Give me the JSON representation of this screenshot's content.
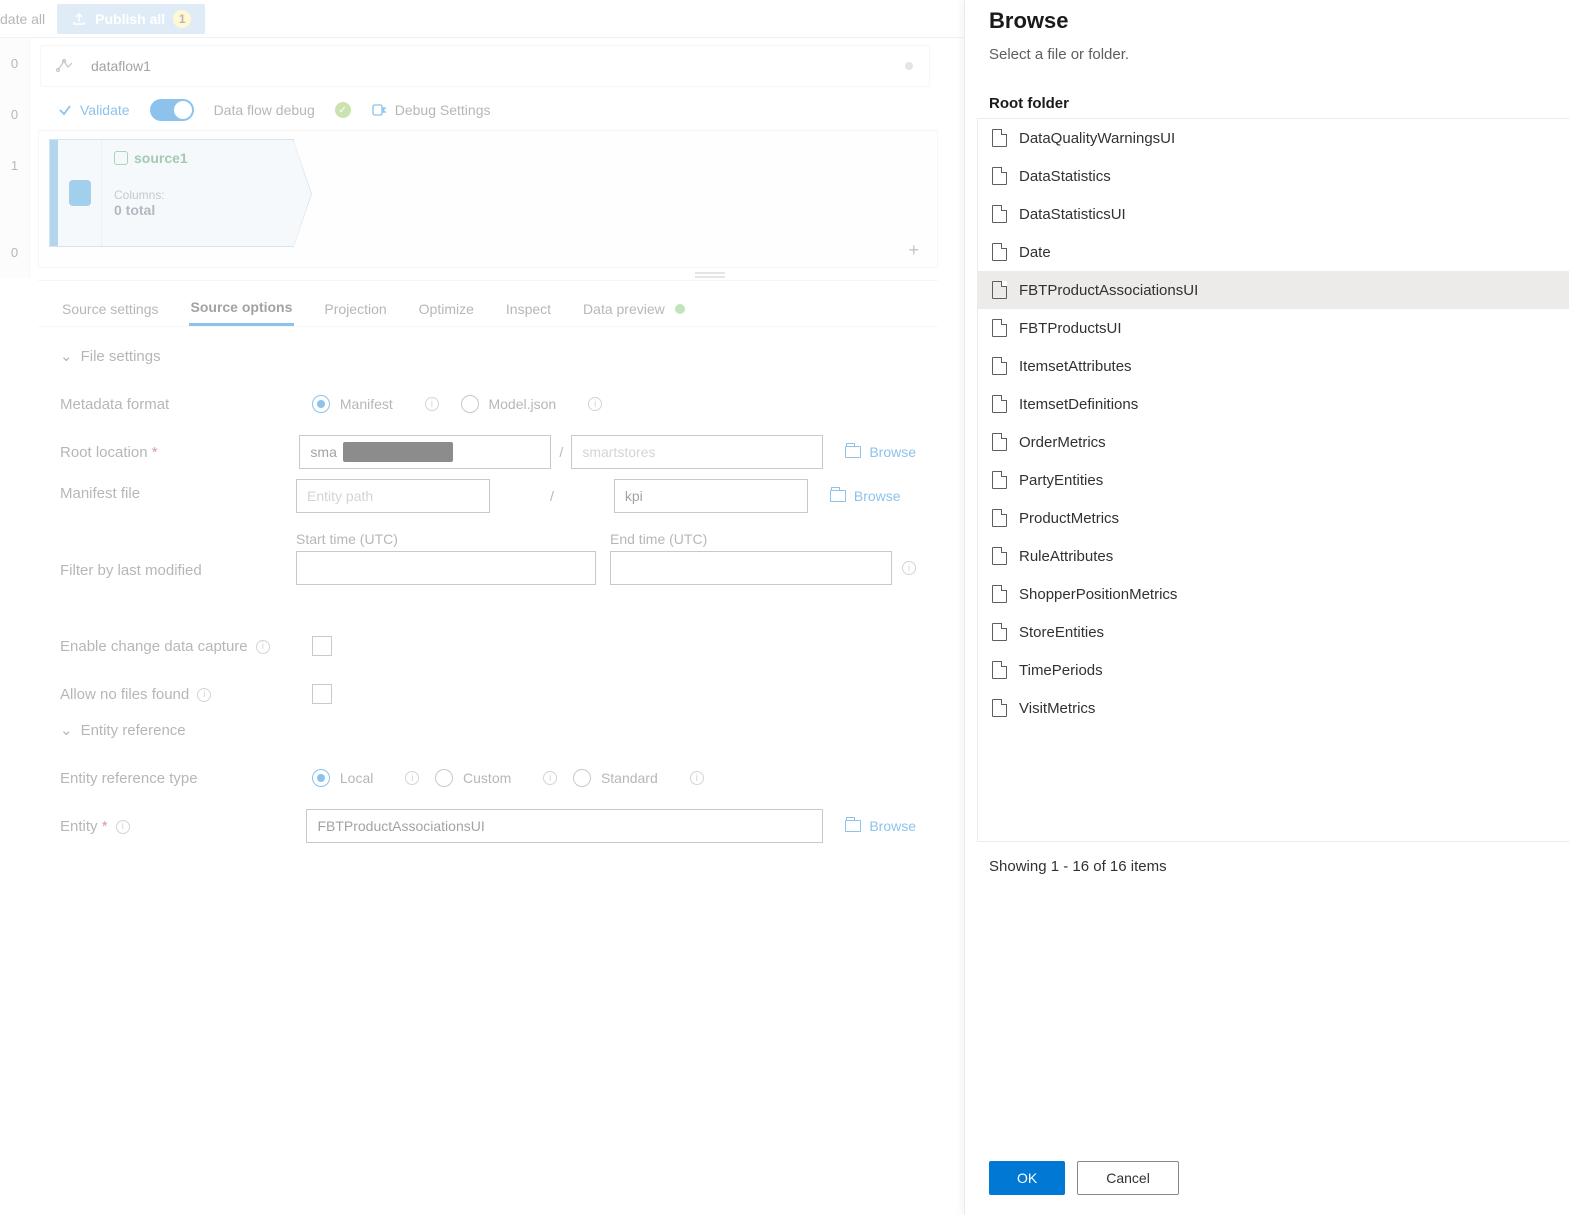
{
  "toolbar": {
    "left_cut": "date all",
    "publish_label": "Publish all",
    "publish_badge": "1"
  },
  "tab": {
    "name": "dataflow1"
  },
  "actions": {
    "validate": "Validate",
    "debug_label": "Data flow debug",
    "debug_settings": "Debug Settings"
  },
  "left_rail": [
    "0",
    "0",
    "1",
    "0"
  ],
  "source_card": {
    "title": "source1",
    "columns_label": "Columns:",
    "total": "0 total"
  },
  "tabs": {
    "source_settings": "Source settings",
    "source_options": "Source options",
    "projection": "Projection",
    "optimize": "Optimize",
    "inspect": "Inspect",
    "data_preview": "Data preview"
  },
  "form": {
    "file_settings": "File settings",
    "metadata_format": "Metadata format",
    "manifest": "Manifest",
    "modeljson": "Model.json",
    "root_location": "Root location",
    "root_prefix": "sma",
    "root_path_placeholder": "smartstores",
    "manifest_file": "Manifest file",
    "entity_path_placeholder": "Entity path",
    "manifest_name": "kpi",
    "browse": "Browse",
    "start_time": "Start time (UTC)",
    "end_time": "End time (UTC)",
    "filter_modified": "Filter by last modified",
    "enable_cdc": "Enable change data capture",
    "allow_no_files": "Allow no files found",
    "entity_reference": "Entity reference",
    "entity_ref_type": "Entity reference type",
    "local": "Local",
    "custom": "Custom",
    "standard": "Standard",
    "entity": "Entity",
    "entity_value": "FBTProductAssociationsUI"
  },
  "panel": {
    "title": "Browse",
    "subtitle": "Select a file or folder.",
    "root_folder": "Root folder",
    "items": [
      "DataQualityWarningsUI",
      "DataStatistics",
      "DataStatisticsUI",
      "Date",
      "FBTProductAssociationsUI",
      "FBTProductsUI",
      "ItemsetAttributes",
      "ItemsetDefinitions",
      "OrderMetrics",
      "PartyEntities",
      "ProductMetrics",
      "RuleAttributes",
      "ShopperPositionMetrics",
      "StoreEntities",
      "TimePeriods",
      "VisitMetrics"
    ],
    "selected_index": 4,
    "status": "Showing 1 - 16 of 16 items",
    "ok": "OK",
    "cancel": "Cancel"
  }
}
